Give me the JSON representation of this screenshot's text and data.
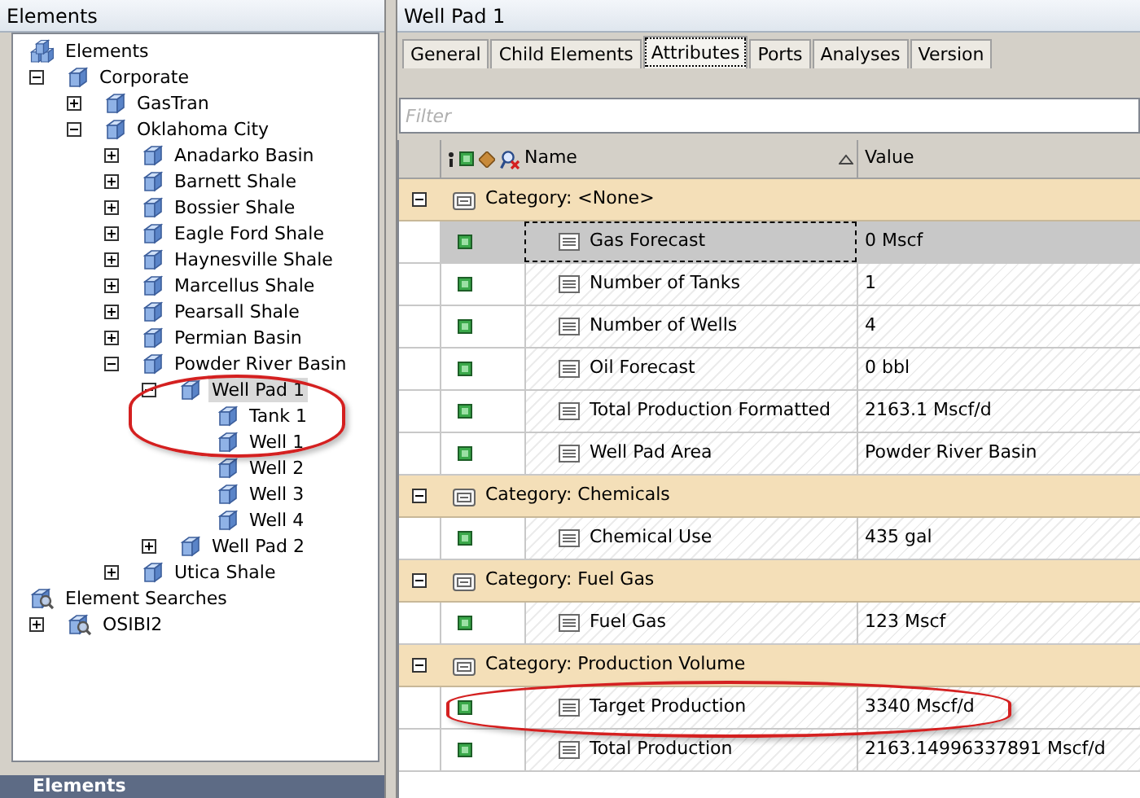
{
  "tree_panel": {
    "title": "Elements",
    "tree": [
      {
        "label": "Elements",
        "kind": "root",
        "selected": false,
        "circled": false,
        "children": [
          {
            "label": "Corporate",
            "kind": "element",
            "expanded": true,
            "selected": false,
            "circled": false,
            "children": [
              {
                "label": "GasTran",
                "kind": "element",
                "expanded": false,
                "selected": false,
                "circled": false
              },
              {
                "label": "Oklahoma City",
                "kind": "element",
                "expanded": true,
                "selected": false,
                "circled": false,
                "children": [
                  {
                    "label": "Anadarko Basin",
                    "kind": "element",
                    "expanded": false,
                    "selected": false,
                    "circled": false
                  },
                  {
                    "label": "Barnett Shale",
                    "kind": "element",
                    "expanded": false,
                    "selected": false,
                    "circled": false
                  },
                  {
                    "label": "Bossier Shale",
                    "kind": "element",
                    "expanded": false,
                    "selected": false,
                    "circled": false
                  },
                  {
                    "label": "Eagle Ford Shale",
                    "kind": "element",
                    "expanded": false,
                    "selected": false,
                    "circled": false
                  },
                  {
                    "label": "Haynesville Shale",
                    "kind": "element",
                    "expanded": false,
                    "selected": false,
                    "circled": false
                  },
                  {
                    "label": "Marcellus Shale",
                    "kind": "element",
                    "expanded": false,
                    "selected": false,
                    "circled": false
                  },
                  {
                    "label": "Pearsall Shale",
                    "kind": "element",
                    "expanded": false,
                    "selected": false,
                    "circled": false
                  },
                  {
                    "label": "Permian Basin",
                    "kind": "element",
                    "expanded": false,
                    "selected": false,
                    "circled": false
                  },
                  {
                    "label": "Powder River Basin",
                    "kind": "element",
                    "expanded": true,
                    "selected": false,
                    "circled": false,
                    "children": [
                      {
                        "label": "Well Pad 1",
                        "kind": "element",
                        "expanded": true,
                        "selected": true,
                        "circled": true,
                        "children": [
                          {
                            "label": "Tank 1",
                            "kind": "element",
                            "selected": false,
                            "circled": true
                          },
                          {
                            "label": "Well 1",
                            "kind": "element",
                            "selected": false,
                            "circled": true
                          },
                          {
                            "label": "Well 2",
                            "kind": "element",
                            "selected": false,
                            "circled": false
                          },
                          {
                            "label": "Well 3",
                            "kind": "element",
                            "selected": false,
                            "circled": false
                          },
                          {
                            "label": "Well 4",
                            "kind": "element",
                            "selected": false,
                            "circled": false
                          }
                        ]
                      },
                      {
                        "label": "Well Pad 2",
                        "kind": "element",
                        "expanded": false,
                        "selected": false,
                        "circled": false
                      }
                    ]
                  },
                  {
                    "label": "Utica Shale",
                    "kind": "element",
                    "expanded": false,
                    "selected": false,
                    "circled": false
                  }
                ]
              }
            ]
          }
        ]
      },
      {
        "label": "Element Searches",
        "kind": "search",
        "selected": false,
        "circled": false,
        "children": [
          {
            "label": "OSIBI2",
            "kind": "search",
            "expanded": false,
            "selected": false,
            "circled": false
          }
        ]
      }
    ],
    "bottom_title": "Elements"
  },
  "detail_panel": {
    "title": "Well Pad 1",
    "tabs": [
      {
        "label": "General",
        "selected": false
      },
      {
        "label": "Child Elements",
        "selected": false
      },
      {
        "label": "Attributes",
        "selected": true
      },
      {
        "label": "Ports",
        "selected": false
      },
      {
        "label": "Analyses",
        "selected": false
      },
      {
        "label": "Version",
        "selected": false
      }
    ],
    "filter": {
      "placeholder": "Filter"
    },
    "columns": [
      {
        "label": "Name",
        "sorted": true
      },
      {
        "label": "Value",
        "sorted": false
      }
    ],
    "categories": [
      {
        "label": "Category: <None>",
        "expanded": true,
        "rows": [
          {
            "name": "Gas Forecast",
            "value": "0 Mscf",
            "selected": true,
            "circled": false
          },
          {
            "name": "Number of Tanks",
            "value": "1",
            "selected": false,
            "circled": false
          },
          {
            "name": "Number of Wells",
            "value": "4",
            "selected": false,
            "circled": false
          },
          {
            "name": "Oil Forecast",
            "value": "0 bbl",
            "selected": false,
            "circled": false
          },
          {
            "name": "Total Production Formatted",
            "value": "2163.1 Mscf/d",
            "selected": false,
            "circled": false
          },
          {
            "name": "Well Pad Area",
            "value": "Powder River Basin",
            "selected": false,
            "circled": false
          }
        ]
      },
      {
        "label": "Category: Chemicals",
        "expanded": true,
        "rows": [
          {
            "name": "Chemical Use",
            "value": "435 gal",
            "selected": false,
            "circled": false
          }
        ]
      },
      {
        "label": "Category: Fuel Gas",
        "expanded": true,
        "rows": [
          {
            "name": "Fuel Gas",
            "value": "123 Mscf",
            "selected": false,
            "circled": false
          }
        ]
      },
      {
        "label": "Category: Production Volume",
        "expanded": true,
        "rows": [
          {
            "name": "Target Production",
            "value": "3340 Mscf/d",
            "selected": false,
            "circled": true
          },
          {
            "name": "Total Production",
            "value": "2163.14996337891 Mscf/d",
            "selected": false,
            "circled": false
          }
        ]
      }
    ]
  }
}
